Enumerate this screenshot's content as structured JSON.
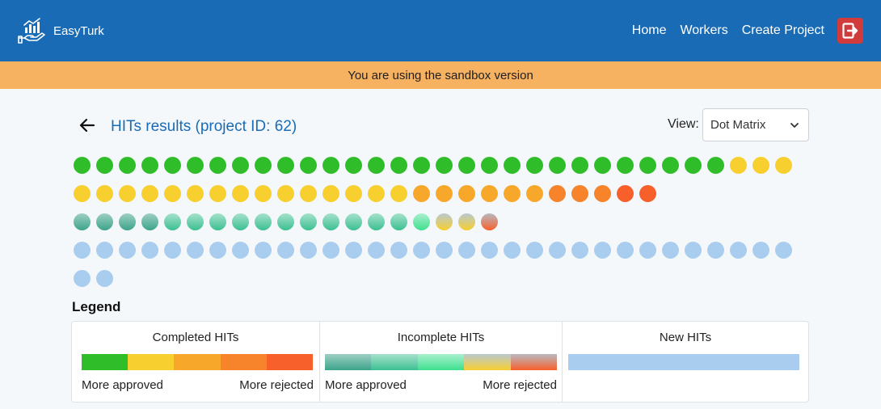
{
  "brand": {
    "name": "EasyTurk"
  },
  "nav": {
    "items": [
      "Home",
      "Workers",
      "Create Project"
    ],
    "logout_icon": "logout-icon"
  },
  "banner": {
    "text": "You are using the sandbox version"
  },
  "page": {
    "title": "HITs results (project ID: 62)",
    "back_icon": "arrow-left-icon"
  },
  "view": {
    "label": "View:",
    "selected": "Dot Matrix"
  },
  "colors": {
    "navbar": "#1a6bb5",
    "banner": "#f6b161",
    "title": "#1a6bb5",
    "logout": "#d13b3b"
  },
  "dots": [
    {
      "status": "completed",
      "color": "#2fbd2a"
    },
    {
      "status": "completed",
      "color": "#2fbd2a"
    },
    {
      "status": "completed",
      "color": "#2fbd2a"
    },
    {
      "status": "completed",
      "color": "#2fbd2a"
    },
    {
      "status": "completed",
      "color": "#2fbd2a"
    },
    {
      "status": "completed",
      "color": "#2fbd2a"
    },
    {
      "status": "completed",
      "color": "#2fbd2a"
    },
    {
      "status": "completed",
      "color": "#2fbd2a"
    },
    {
      "status": "completed",
      "color": "#2fbd2a"
    },
    {
      "status": "completed",
      "color": "#2fbd2a"
    },
    {
      "status": "completed",
      "color": "#2fbd2a"
    },
    {
      "status": "completed",
      "color": "#2fbd2a"
    },
    {
      "status": "completed",
      "color": "#2fbd2a"
    },
    {
      "status": "completed",
      "color": "#2fbd2a"
    },
    {
      "status": "completed",
      "color": "#2fbd2a"
    },
    {
      "status": "completed",
      "color": "#2fbd2a"
    },
    {
      "status": "completed",
      "color": "#2fbd2a"
    },
    {
      "status": "completed",
      "color": "#2fbd2a"
    },
    {
      "status": "completed",
      "color": "#2fbd2a"
    },
    {
      "status": "completed",
      "color": "#2fbd2a"
    },
    {
      "status": "completed",
      "color": "#2fbd2a"
    },
    {
      "status": "completed",
      "color": "#2fbd2a"
    },
    {
      "status": "completed",
      "color": "#2fbd2a"
    },
    {
      "status": "completed",
      "color": "#2fbd2a"
    },
    {
      "status": "completed",
      "color": "#2fbd2a"
    },
    {
      "status": "completed",
      "color": "#2fbd2a"
    },
    {
      "status": "completed",
      "color": "#2fbd2a"
    },
    {
      "status": "completed",
      "color": "#2fbd2a"
    },
    {
      "status": "completed",
      "color": "#2fbd2a"
    },
    {
      "status": "completed",
      "color": "#f7cf2f"
    },
    {
      "status": "completed",
      "color": "#f7cf2f"
    },
    {
      "status": "completed",
      "color": "#f7cf2f"
    },
    {
      "status": "completed",
      "color": "#f7cf2f"
    },
    {
      "status": "completed",
      "color": "#f7cf2f"
    },
    {
      "status": "completed",
      "color": "#f7cf2f"
    },
    {
      "status": "completed",
      "color": "#f7cf2f"
    },
    {
      "status": "completed",
      "color": "#f7cf2f"
    },
    {
      "status": "completed",
      "color": "#f7cf2f"
    },
    {
      "status": "completed",
      "color": "#f7cf2f"
    },
    {
      "status": "completed",
      "color": "#f7cf2f"
    },
    {
      "status": "completed",
      "color": "#f7cf2f"
    },
    {
      "status": "completed",
      "color": "#f7cf2f"
    },
    {
      "status": "completed",
      "color": "#f7cf2f"
    },
    {
      "status": "completed",
      "color": "#f7cf2f"
    },
    {
      "status": "completed",
      "color": "#f7cf2f"
    },
    {
      "status": "completed",
      "color": "#f7cf2f"
    },
    {
      "status": "completed",
      "color": "#f7cf2f"
    },
    {
      "status": "completed",
      "color": "#f7a82b"
    },
    {
      "status": "completed",
      "color": "#f7a82b"
    },
    {
      "status": "completed",
      "color": "#f7a82b"
    },
    {
      "status": "completed",
      "color": "#f7a82b"
    },
    {
      "status": "completed",
      "color": "#f7a82b"
    },
    {
      "status": "completed",
      "color": "#f7a82b"
    },
    {
      "status": "completed",
      "color": "#f7832b"
    },
    {
      "status": "completed",
      "color": "#f7832b"
    },
    {
      "status": "completed",
      "color": "#f7832b"
    },
    {
      "status": "completed",
      "color": "#f7602b"
    },
    {
      "status": "completed",
      "color": "#f7602b"
    },
    {
      "status": "incomplete",
      "color": "linear-gradient(to bottom, #9ecfc4 0%, #3ca48a 100%)"
    },
    {
      "status": "incomplete",
      "color": "linear-gradient(to bottom, #9ecfc4 0%, #3ca48a 100%)"
    },
    {
      "status": "incomplete",
      "color": "linear-gradient(to bottom, #9ecfc4 0%, #3ca48a 100%)"
    },
    {
      "status": "incomplete",
      "color": "linear-gradient(to bottom, #9ecfc4 0%, #3ca48a 100%)"
    },
    {
      "status": "incomplete",
      "color": "linear-gradient(to bottom, #a6e1cc 0%, #3cc091 100%)"
    },
    {
      "status": "incomplete",
      "color": "linear-gradient(to bottom, #a6e1cc 0%, #3cc091 100%)"
    },
    {
      "status": "incomplete",
      "color": "linear-gradient(to bottom, #a6e1cc 0%, #3cc091 100%)"
    },
    {
      "status": "incomplete",
      "color": "linear-gradient(to bottom, #a6e1cc 0%, #3cc091 100%)"
    },
    {
      "status": "incomplete",
      "color": "linear-gradient(to bottom, #a6e1cc 0%, #3cc091 100%)"
    },
    {
      "status": "incomplete",
      "color": "linear-gradient(to bottom, #a6e1cc 0%, #3cc091 100%)"
    },
    {
      "status": "incomplete",
      "color": "linear-gradient(to bottom, #a6e1cc 0%, #3cc091 100%)"
    },
    {
      "status": "incomplete",
      "color": "linear-gradient(to bottom, #a6e1cc 0%, #3cc091 100%)"
    },
    {
      "status": "incomplete",
      "color": "linear-gradient(to bottom, #a6e1cc 0%, #3cc091 100%)"
    },
    {
      "status": "incomplete",
      "color": "linear-gradient(to bottom, #a6e1cc 0%, #3cc091 100%)"
    },
    {
      "status": "incomplete",
      "color": "linear-gradient(to bottom, #a6e1cc 0%, #3cc091 100%)"
    },
    {
      "status": "incomplete",
      "color": "linear-gradient(to bottom, #a9f0cd 0%, #3ee08f 100%)"
    },
    {
      "status": "incomplete",
      "color": "linear-gradient(to bottom, #b9c9cf 0%, #f7cf2f 100%)"
    },
    {
      "status": "incomplete",
      "color": "linear-gradient(to bottom, #b9c9cf 0%, #f7cf2f 100%)"
    },
    {
      "status": "incomplete",
      "color": "linear-gradient(to bottom, #b9b9c0 0%, #f7602b 100%)"
    },
    {
      "status": "new",
      "color": "#a9cdee"
    },
    {
      "status": "new",
      "color": "#a9cdee"
    },
    {
      "status": "new",
      "color": "#a9cdee"
    },
    {
      "status": "new",
      "color": "#a9cdee"
    },
    {
      "status": "new",
      "color": "#a9cdee"
    },
    {
      "status": "new",
      "color": "#a9cdee"
    },
    {
      "status": "new",
      "color": "#a9cdee"
    },
    {
      "status": "new",
      "color": "#a9cdee"
    },
    {
      "status": "new",
      "color": "#a9cdee"
    },
    {
      "status": "new",
      "color": "#a9cdee"
    },
    {
      "status": "new",
      "color": "#a9cdee"
    },
    {
      "status": "new",
      "color": "#a9cdee"
    },
    {
      "status": "new",
      "color": "#a9cdee"
    },
    {
      "status": "new",
      "color": "#a9cdee"
    },
    {
      "status": "new",
      "color": "#a9cdee"
    },
    {
      "status": "new",
      "color": "#a9cdee"
    },
    {
      "status": "new",
      "color": "#a9cdee"
    },
    {
      "status": "new",
      "color": "#a9cdee"
    },
    {
      "status": "new",
      "color": "#a9cdee"
    },
    {
      "status": "new",
      "color": "#a9cdee"
    },
    {
      "status": "new",
      "color": "#a9cdee"
    },
    {
      "status": "new",
      "color": "#a9cdee"
    },
    {
      "status": "new",
      "color": "#a9cdee"
    },
    {
      "status": "new",
      "color": "#a9cdee"
    },
    {
      "status": "new",
      "color": "#a9cdee"
    },
    {
      "status": "new",
      "color": "#a9cdee"
    },
    {
      "status": "new",
      "color": "#a9cdee"
    },
    {
      "status": "new",
      "color": "#a9cdee"
    },
    {
      "status": "new",
      "color": "#a9cdee"
    },
    {
      "status": "new",
      "color": "#a9cdee"
    },
    {
      "status": "new",
      "color": "#a9cdee"
    },
    {
      "status": "new",
      "color": "#a9cdee"
    },
    {
      "status": "new",
      "color": "#a9cdee"
    },
    {
      "status": "new",
      "color": "#a9cdee"
    }
  ],
  "legend": {
    "title": "Legend",
    "columns": [
      {
        "heading": "Completed HITs",
        "swatches": [
          "#2fbd2a",
          "#f7cf2f",
          "#f7a82b",
          "#f7832b",
          "#f7602b"
        ],
        "left": "More approved",
        "right": "More rejected"
      },
      {
        "heading": "Incomplete HITs",
        "swatches": [
          "linear-gradient(to bottom, #9ecfc4 0%, #3ca48a 100%)",
          "linear-gradient(to bottom, #a6e1cc 0%, #3cc091 100%)",
          "linear-gradient(to bottom, #a9f0cd 0%, #3ee08f 100%)",
          "linear-gradient(to bottom, #b9c9cf 0%, #f7cf2f 100%)",
          "linear-gradient(to bottom, #b9b9c0 0%, #f7602b 100%)"
        ],
        "left": "More approved",
        "right": "More rejected"
      },
      {
        "heading": "New HITs",
        "swatches": [
          "#a9cdee"
        ],
        "left": "",
        "right": ""
      }
    ]
  }
}
